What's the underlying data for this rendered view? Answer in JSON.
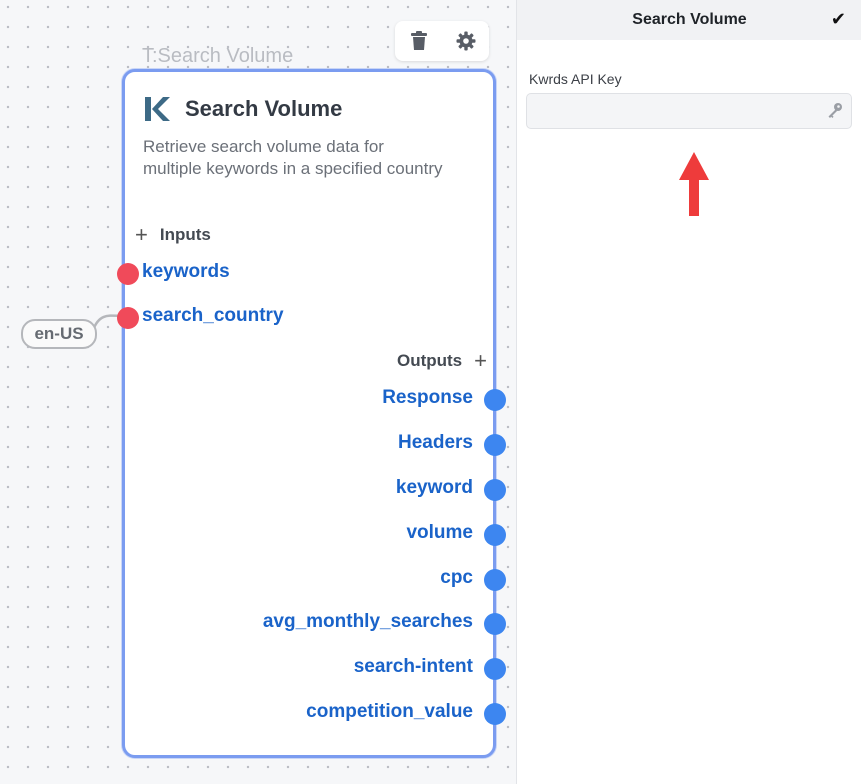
{
  "canvas": {
    "node_caption": "T:Search Volume",
    "connected_value": "en-US",
    "toolbar": {
      "delete_icon": "trash-icon",
      "settings_icon": "gear-icon"
    }
  },
  "node": {
    "logo_icon": "kwrds-k-logo",
    "title": "Search Volume",
    "description": "Retrieve search volume data for multiple keywords in a specified country",
    "inputs_label": "Inputs",
    "outputs_label": "Outputs",
    "add_symbol": "+",
    "inputs": [
      "keywords",
      "search_country"
    ],
    "outputs": [
      "Response",
      "Headers",
      "keyword",
      "volume",
      "cpc",
      "avg_monthly_searches",
      "search-intent",
      "competition_value"
    ]
  },
  "panel": {
    "title": "Search Volume",
    "confirm_symbol": "✔",
    "field_label": "Kwrds API Key",
    "field_value": "",
    "field_icon": "key-icon",
    "annotation": "red-up-arrow"
  },
  "colors": {
    "node_border": "#7b9cf0",
    "input_port": "#f04a5a",
    "output_port": "#3d86f0",
    "port_label": "#1a63c9",
    "arrow": "#ee3b3b"
  }
}
